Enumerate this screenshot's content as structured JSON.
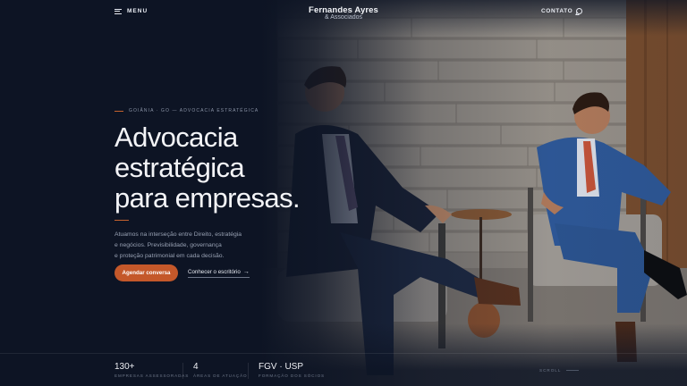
{
  "header": {
    "menu_label": "MENU",
    "logo_name": "Fernandes Ayres",
    "logo_sub": "& Associados",
    "contact_label": "CONTATO"
  },
  "hero": {
    "eyebrow": "GOIÂNIA · GO — ADVOCACIA ESTRATÉGICA",
    "headline_lines": [
      "Advocacia",
      "estratégica",
      "para empresas."
    ],
    "lead_lines": [
      "Atuamos na interseção entre Direito, estratégia",
      "e negócios. Previsibilidade, governança",
      "e proteção patrimonial em cada decisão."
    ],
    "cta_primary": "Agendar conversa",
    "cta_secondary": "Conhecer o escritório"
  },
  "stats": [
    {
      "value": "130+",
      "label": "EMPRESAS ASSESSORADAS"
    },
    {
      "value": "4",
      "label": "ÁREAS DE ATUAÇÃO"
    },
    {
      "value": "FGV · USP",
      "label": "FORMAÇÃO DOS SÓCIOS"
    }
  ],
  "scroll_label": "SCROLL",
  "icons": {
    "menu": "hamburger-icon",
    "contact": "whatsapp-icon",
    "cta_secondary": "arrow-right-icon"
  },
  "colors": {
    "background": "#0d1424",
    "accent": "#c4582a"
  }
}
